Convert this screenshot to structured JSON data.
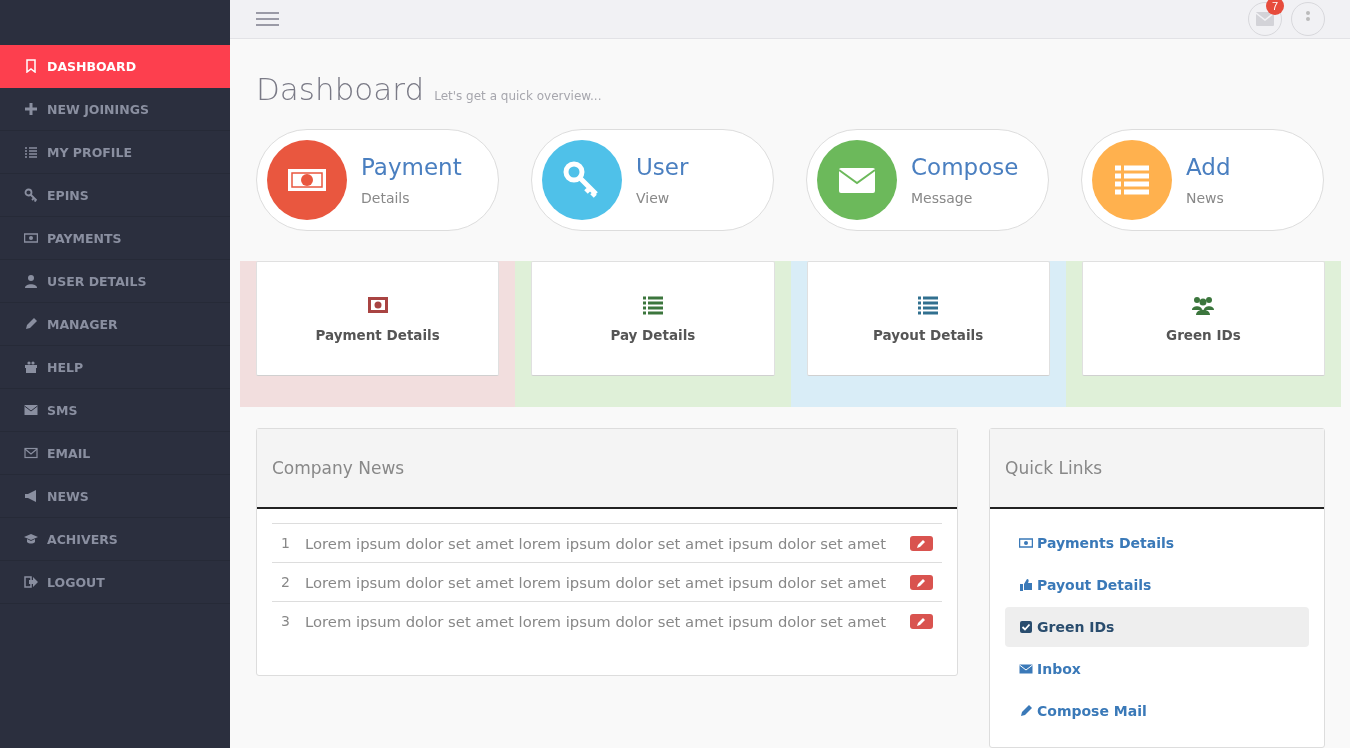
{
  "sidebar": {
    "items": [
      {
        "label": "DASHBOARD",
        "selected": true
      },
      {
        "label": "NEW JOININGS",
        "selected": false
      },
      {
        "label": "MY PROFILE",
        "selected": false
      },
      {
        "label": "EPINS",
        "selected": false
      },
      {
        "label": "PAYMENTS",
        "selected": false
      },
      {
        "label": "USER DETAILS",
        "selected": false
      },
      {
        "label": "MANAGER",
        "selected": false
      },
      {
        "label": "HELP",
        "selected": false
      },
      {
        "label": "SMS",
        "selected": false
      },
      {
        "label": "EMAIL",
        "selected": false
      },
      {
        "label": "NEWS",
        "selected": false
      },
      {
        "label": "ACHIVERS",
        "selected": false
      },
      {
        "label": "LOGOUT",
        "selected": false
      }
    ]
  },
  "topbar": {
    "mail_badge": "7"
  },
  "page_header": {
    "title": "Dashboard",
    "subtitle": "Let's get a quick overview..."
  },
  "shortcut_cards": [
    {
      "title": "Payment",
      "subtitle": "Details",
      "color": "#e9573f"
    },
    {
      "title": "User",
      "subtitle": "View",
      "color": "#4fc1e9"
    },
    {
      "title": "Compose",
      "subtitle": "Message",
      "color": "#6cb95b"
    },
    {
      "title": "Add",
      "subtitle": "News",
      "color": "#ffb14e"
    }
  ],
  "tiles": [
    {
      "label": "Payment Details",
      "icon": {
        "color": "#a94442"
      },
      "band": {
        "color": "#f2dede"
      }
    },
    {
      "label": "Pay Details",
      "icon": {
        "color": "#3c763d"
      },
      "band": {
        "color": "#dff0d8"
      }
    },
    {
      "label": "Payout Details",
      "icon": {
        "color": "#31708f"
      },
      "band": {
        "color": "#d9edf7"
      }
    },
    {
      "label": "Green IDs",
      "icon": {
        "color": "#3c763d"
      },
      "band": {
        "color": "#dff0d8"
      }
    }
  ],
  "company_news": {
    "title": "Company News",
    "rows": [
      {
        "number": "1",
        "text": "Lorem ipsum dolor set amet lorem ipsum dolor set amet ipsum dolor set amet"
      },
      {
        "number": "2",
        "text": "Lorem ipsum dolor set amet lorem ipsum dolor set amet ipsum dolor set amet"
      },
      {
        "number": "3",
        "text": "Lorem ipsum dolor set amet lorem ipsum dolor set amet ipsum dolor set amet"
      }
    ]
  },
  "quick_links": {
    "title": "Quick Links",
    "items": [
      {
        "label": "Payments Details",
        "selected": false
      },
      {
        "label": "Payout Details",
        "selected": false
      },
      {
        "label": "Green IDs",
        "selected": true
      },
      {
        "label": "Inbox",
        "selected": false
      },
      {
        "label": "Compose Mail",
        "selected": false
      }
    ]
  }
}
